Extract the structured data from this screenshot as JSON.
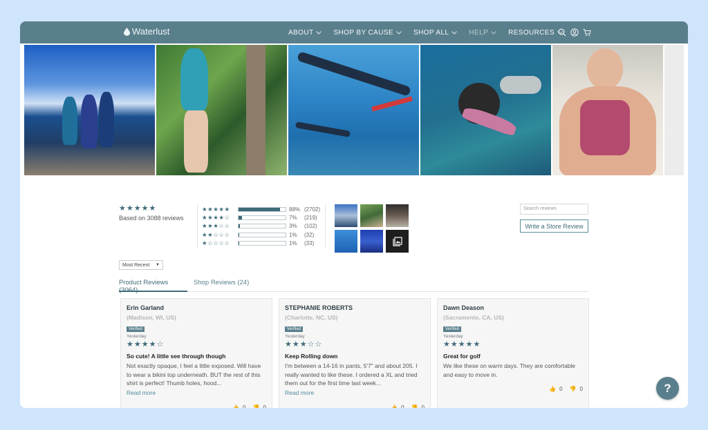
{
  "brand": {
    "name": "Waterlust",
    "accent": "#5a7f8c"
  },
  "nav": {
    "items": [
      {
        "label": "ABOUT"
      },
      {
        "label": "SHOP BY CAUSE"
      },
      {
        "label": "SHOP ALL"
      },
      {
        "label": "HELP"
      },
      {
        "label": "RESOURCES"
      }
    ],
    "icons": [
      "search-icon",
      "account-icon",
      "cart-icon"
    ]
  },
  "summary": {
    "stars": "★★★★★",
    "based_on": "Based on 3088 reviews"
  },
  "histogram": [
    {
      "stars": "★★★★★",
      "pct": "88%",
      "count": "(2702)",
      "fraction": 0.88
    },
    {
      "stars": "★★★★☆",
      "pct": "7%",
      "count": "(219)",
      "fraction": 0.07
    },
    {
      "stars": "★★★☆☆",
      "pct": "3%",
      "count": "(102)",
      "fraction": 0.03
    },
    {
      "stars": "★★☆☆☆",
      "pct": "1%",
      "count": "(32)",
      "fraction": 0.01
    },
    {
      "stars": "★☆☆☆☆",
      "pct": "1%",
      "count": "(33)",
      "fraction": 0.01
    }
  ],
  "search": {
    "placeholder": "Search reviews"
  },
  "write_review": {
    "label": "Write a Store Review"
  },
  "sort": {
    "selected": "Most Recent"
  },
  "tabs": {
    "product": "Product Reviews (3064)",
    "shop": "Shop Reviews (24)"
  },
  "reviews": [
    {
      "name": "Erin Garland",
      "location": "(Madison, WI, US)",
      "badge": "Verified",
      "date": "Yesterday",
      "stars": "★★★★☆",
      "title": "So cute! A little see through though",
      "body": "Not exactly opaque, I feel a little exposed. Will have to wear a bikini top underneath. BUT the rest of this shirt is perfect! Thumb holes, hood...",
      "read_more": "Read more",
      "up": "0",
      "down": "0"
    },
    {
      "name": "STEPHANIE ROBERTS",
      "location": "(Charlotte, NC, US)",
      "badge": "Verified",
      "date": "Yesterday",
      "stars": "★★★☆☆",
      "title": "Keep Rolling down",
      "body": "I'm between a 14-16 in pants, 5'7\" and about 205. I really wanted to like these. I ordered a XL and tried them out for the first time last week...",
      "read_more": "Read more",
      "up": "0",
      "down": "0"
    },
    {
      "name": "Dawn Deason",
      "location": "(Sacramento, CA, US)",
      "badge": "Verified",
      "date": "Yesterday",
      "stars": "★★★★★",
      "title": "Great for golf",
      "body": "We like these on warm days. They are comfortable and easy to move in.",
      "up": "0",
      "down": "0"
    }
  ],
  "help_button": {
    "label": "?"
  }
}
